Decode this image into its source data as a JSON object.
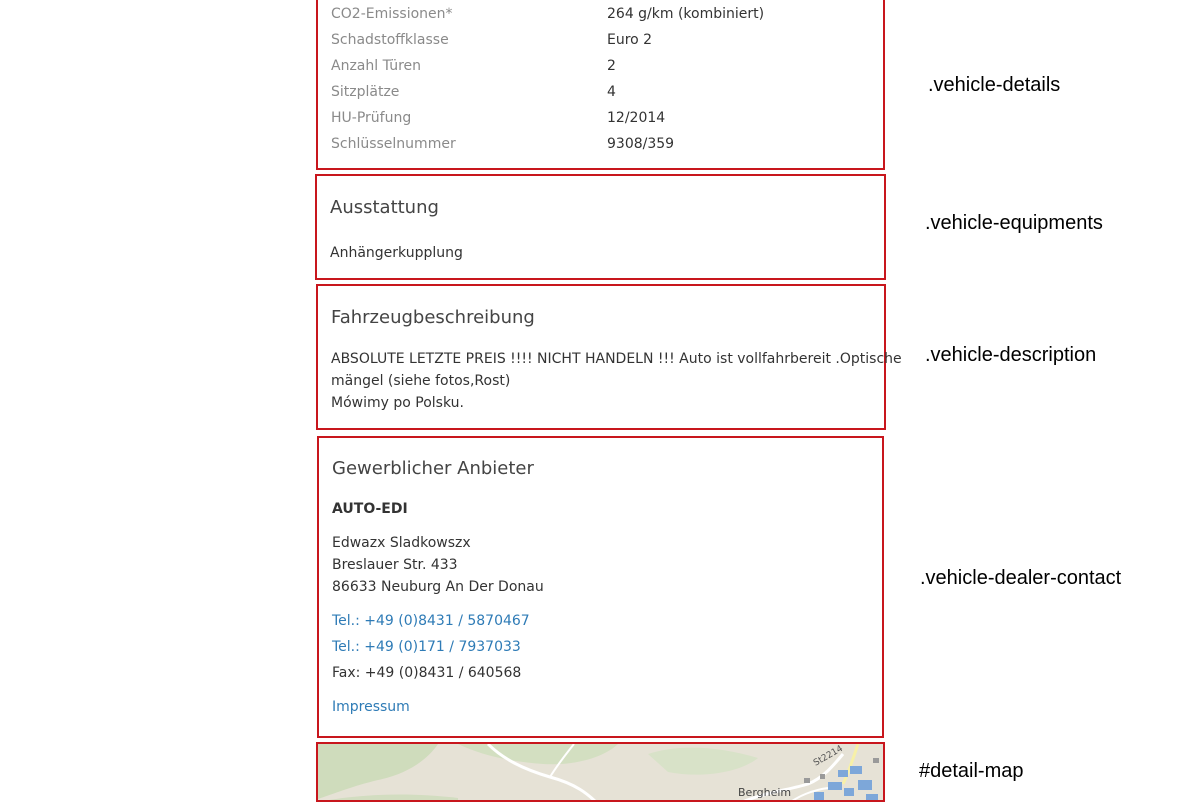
{
  "details": {
    "rows": [
      {
        "label": "CO2-Emissionen*",
        "value": "264 g/km (kombiniert)"
      },
      {
        "label": "Schadstoffklasse",
        "value": "Euro 2"
      },
      {
        "label": "Anzahl Türen",
        "value": "2"
      },
      {
        "label": "Sitzplätze",
        "value": "4"
      },
      {
        "label": "HU-Prüfung",
        "value": "12/2014"
      },
      {
        "label": "Schlüsselnummer",
        "value": "9308/359"
      }
    ]
  },
  "equipments": {
    "heading": "Ausstattung",
    "items": "Anhängerkupplung"
  },
  "description": {
    "heading": "Fahrzeugbeschreibung",
    "line1": "ABSOLUTE LETZTE PREIS !!!! NICHT HANDELN !!! Auto ist vollfahrbereit .Optische",
    "line2": "mängel (siehe fotos,Rost)",
    "line3": "Mówimy po Polsku."
  },
  "dealer": {
    "heading": "Gewerblicher Anbieter",
    "company": "AUTO-EDI",
    "contact_name": "Edwazx Sladkowszx",
    "street": "Breslauer Str. 433",
    "city": "86633 Neuburg An Der Donau",
    "tel1": "Tel.: +49 (0)8431 / 5870467",
    "tel2": "Tel.: +49 (0)171 / 7937033",
    "fax": "Fax: +49 (0)8431 / 640568",
    "impressum": "Impressum"
  },
  "map": {
    "road_label": "St2214",
    "town_label": "Bergheim"
  },
  "annotations": {
    "details": ".vehicle-details",
    "equipments": ".vehicle-equipments",
    "description": ".vehicle-description",
    "dealer": ".vehicle-dealer-contact",
    "map": "#detail-map"
  },
  "colors": {
    "outline": "#c8161d",
    "link": "#2e7bb6",
    "label_gray": "#8a8a8a"
  }
}
